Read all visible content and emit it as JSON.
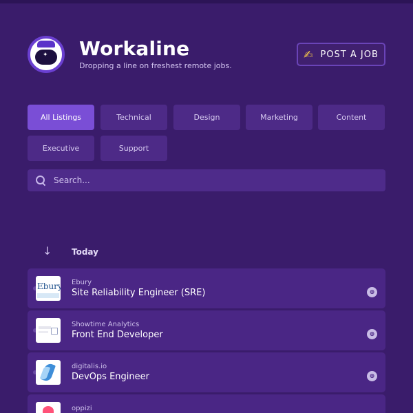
{
  "header": {
    "brand": "Workaline",
    "tagline": "Dropping a line on freshest remote jobs.",
    "post_job_label": "POST A JOB"
  },
  "filters": [
    {
      "label": "All Listings",
      "active": true
    },
    {
      "label": "Technical",
      "active": false
    },
    {
      "label": "Design",
      "active": false
    },
    {
      "label": "Marketing",
      "active": false
    },
    {
      "label": "Content",
      "active": false
    },
    {
      "label": "Executive",
      "active": false
    },
    {
      "label": "Support",
      "active": false
    }
  ],
  "search": {
    "placeholder": "Search...",
    "value": ""
  },
  "section": {
    "label": "Today"
  },
  "jobs": [
    {
      "company": "Ebury",
      "title": "Site Reliability Engineer (SRE)",
      "logo_text": "Ebury"
    },
    {
      "company": "Showtime Analytics",
      "title": "Front End Developer"
    },
    {
      "company": "digitalis.io",
      "title": "DevOps Engineer"
    },
    {
      "company": "oppizi",
      "title": ""
    }
  ],
  "colors": {
    "background": "#3a1c6b",
    "accent": "#7a4ed6",
    "card": "#4a2685"
  }
}
